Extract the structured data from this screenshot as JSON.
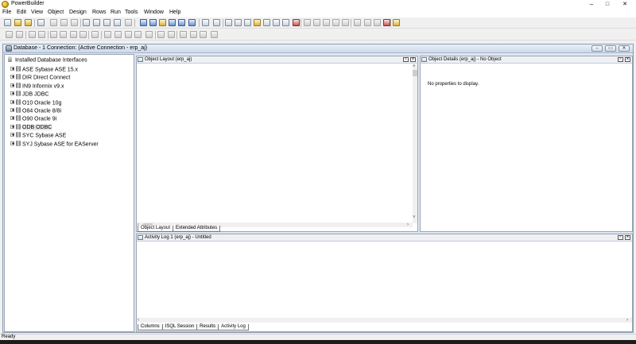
{
  "app": {
    "title": "PowerBuilder"
  },
  "window_controls": {
    "minimize": "–",
    "maximize": "□",
    "close": "✕"
  },
  "menu": [
    {
      "id": "file",
      "label": "File"
    },
    {
      "id": "edit",
      "label": "Edit"
    },
    {
      "id": "view",
      "label": "View"
    },
    {
      "id": "object",
      "label": "Object"
    },
    {
      "id": "design",
      "label": "Design"
    },
    {
      "id": "rows",
      "label": "Rows"
    },
    {
      "id": "run",
      "label": "Run"
    },
    {
      "id": "tools",
      "label": "Tools"
    },
    {
      "id": "window",
      "label": "Window"
    },
    {
      "id": "help",
      "label": "Help"
    }
  ],
  "db_window": {
    "title": "Database - 1 Connection: (Active Connection - erp_aj)",
    "buttons": {
      "minimize": "–",
      "restore": "▭",
      "close": "✕"
    }
  },
  "tree": {
    "root_label": "Installed Database Interfaces",
    "items": [
      {
        "code": "ASE",
        "label": "ASE Sybase ASE 15.x",
        "selected": false
      },
      {
        "code": "DIR",
        "label": "DIR Direct Connect",
        "selected": false
      },
      {
        "code": "IN9",
        "label": "IN9 Informix v9.x",
        "selected": false
      },
      {
        "code": "JDB",
        "label": "JDB JDBC",
        "selected": false
      },
      {
        "code": "O10",
        "label": "O10 Oracle 10g",
        "selected": false
      },
      {
        "code": "O84",
        "label": "O84 Oracle 8/8i",
        "selected": false
      },
      {
        "code": "O90",
        "label": "O90 Oracle 9i",
        "selected": false
      },
      {
        "code": "ODB",
        "label": "ODB ODBC",
        "selected": true
      },
      {
        "code": "SYC",
        "label": "SYC Sybase ASE",
        "selected": false
      },
      {
        "code": "SYJ",
        "label": "SYJ Sybase ASE for EAServer",
        "selected": false
      }
    ]
  },
  "object_layout": {
    "title": "Object Layout (erp_aj)",
    "tabs": [
      "Object Layout",
      "Extended Attributes"
    ]
  },
  "object_details": {
    "title": "Object Details (erp_aj) - No Object",
    "message": "No properties to display."
  },
  "activity_log": {
    "title": "Activity Log 1 (erp_aj) - Untitled",
    "tabs": [
      "Columns",
      "ISQL Session",
      "Results",
      "Activity Log"
    ]
  },
  "status": {
    "text": "Ready"
  }
}
